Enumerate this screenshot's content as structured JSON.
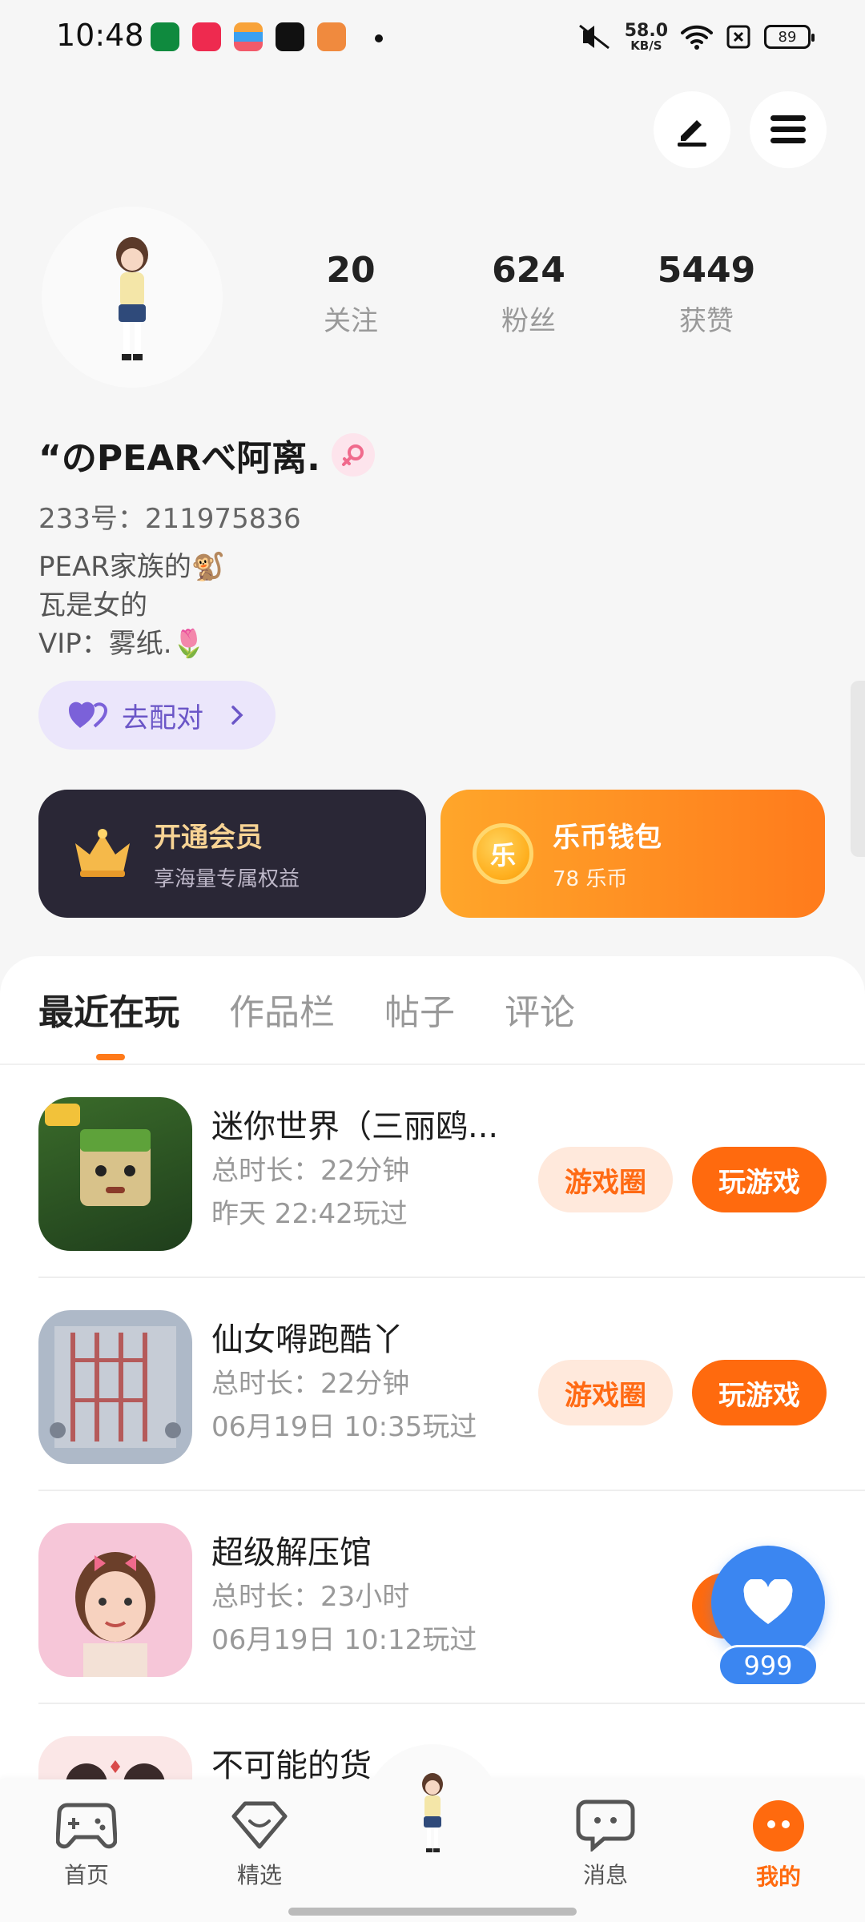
{
  "status_bar": {
    "time": "10:48",
    "net_speed": "58.0",
    "net_unit": "KB/S",
    "battery": "89"
  },
  "profile": {
    "nickname": "“のPEARべ阿离.",
    "id_label": "233号：",
    "id_value": "211975836",
    "bio": [
      "PEAR家族的🐒",
      "瓦是女的",
      "VIP：雾纸.🌷"
    ],
    "pair_button": "去配对",
    "stats": [
      {
        "value": "20",
        "label": "关注"
      },
      {
        "value": "624",
        "label": "粉丝"
      },
      {
        "value": "5449",
        "label": "获赞"
      }
    ]
  },
  "cards": {
    "vip": {
      "title": "开通会员",
      "subtitle": "享海量专属权益"
    },
    "wallet": {
      "title": "乐币钱包",
      "subtitle": "78 乐币",
      "coin_char": "乐"
    }
  },
  "tabs": [
    "最近在玩",
    "作品栏",
    "帖子",
    "评论"
  ],
  "games": [
    {
      "title": "迷你世界（三丽鸥...",
      "duration": "总时长：22分钟",
      "last_played": "昨天 22:42玩过",
      "circle_label": "游戏圈",
      "play_label": "玩游戏"
    },
    {
      "title": "仙女嘚跑酷丫",
      "duration": "总时长：22分钟",
      "last_played": "06月19日 10:35玩过",
      "circle_label": "游戏圈",
      "play_label": "玩游戏"
    },
    {
      "title": "超级解压馆",
      "duration": "总时长：23小时",
      "last_played": "06月19日 10:12玩过"
    },
    {
      "title": "不可能的货"
    }
  ],
  "float_like": {
    "count": "999"
  },
  "nav": [
    {
      "label": "首页",
      "icon": "gamepad-icon"
    },
    {
      "label": "精选",
      "icon": "heart-badge-icon"
    },
    {
      "label": "消息",
      "icon": "chat-icon"
    },
    {
      "label": "我的",
      "icon": "me-icon"
    }
  ],
  "colors": {
    "accent": "#ff6a0e",
    "vip_bg": "#2a2736",
    "like_blue": "#3b86f1"
  }
}
